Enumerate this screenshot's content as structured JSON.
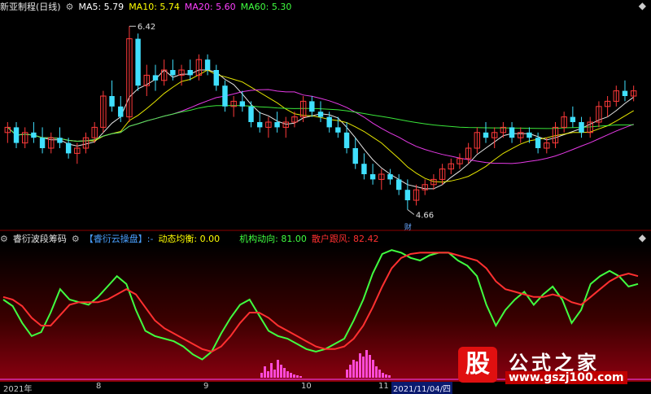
{
  "main_header": {
    "title": "新亚制程(日线)",
    "ma": [
      {
        "label": "MA5: 5.79",
        "color": "#ffffff"
      },
      {
        "label": "MA10: 5.74",
        "color": "#ffff00"
      },
      {
        "label": "MA20: 5.60",
        "color": "#ff40ff"
      },
      {
        "label": "MA60: 5.30",
        "color": "#40ff40"
      }
    ]
  },
  "main_chart": {
    "high_label": "6.42",
    "low_label": "4.66",
    "marker_cai": "财",
    "price_range": [
      4.5,
      6.5
    ]
  },
  "sub_header": {
    "title": "睿衍波段筹码",
    "indicator": "【睿衍云操盘】:-",
    "dynamic_label": "动态均衡: 0.00",
    "inst_label": "机构动向: 81.00",
    "retail_label": "散户跟风: 82.42",
    "colors": {
      "dynamic": "#ffff00",
      "inst": "#40ff40",
      "retail": "#ff3030"
    }
  },
  "xaxis": {
    "ticks": [
      "2021年",
      "8",
      "9",
      "10",
      "11"
    ],
    "cursor_date": "2021/11/04/四"
  },
  "watermark": {
    "icon_text": "股",
    "name": "公式之家",
    "url": "www.gszj100.com"
  },
  "chart_data": [
    {
      "type": "candlestick",
      "title": "新亚制程(日线)",
      "ylim": [
        4.5,
        6.5
      ],
      "candles": [
        [
          5.4,
          5.5,
          5.3,
          5.45
        ],
        [
          5.45,
          5.5,
          5.25,
          5.3
        ],
        [
          5.3,
          5.45,
          5.25,
          5.4
        ],
        [
          5.4,
          5.5,
          5.3,
          5.35
        ],
        [
          5.35,
          5.45,
          5.2,
          5.25
        ],
        [
          5.25,
          5.4,
          5.2,
          5.35
        ],
        [
          5.35,
          5.45,
          5.25,
          5.3
        ],
        [
          5.3,
          5.35,
          5.15,
          5.2
        ],
        [
          5.2,
          5.3,
          5.1,
          5.25
        ],
        [
          5.25,
          5.4,
          5.2,
          5.35
        ],
        [
          5.35,
          5.5,
          5.3,
          5.45
        ],
        [
          5.45,
          5.8,
          5.4,
          5.75
        ],
        [
          5.75,
          5.9,
          5.6,
          5.65
        ],
        [
          5.65,
          5.75,
          5.5,
          5.55
        ],
        [
          5.55,
          6.42,
          5.5,
          6.3
        ],
        [
          6.3,
          6.35,
          5.8,
          5.85
        ],
        [
          5.85,
          6.05,
          5.75,
          5.95
        ],
        [
          5.95,
          6.05,
          5.8,
          5.9
        ],
        [
          5.9,
          6.1,
          5.85,
          6.0
        ],
        [
          6.0,
          6.1,
          5.9,
          5.95
        ],
        [
          5.95,
          6.05,
          5.85,
          6.0
        ],
        [
          6.0,
          6.1,
          5.9,
          5.95
        ],
        [
          5.95,
          6.15,
          5.9,
          6.1
        ],
        [
          6.1,
          6.15,
          5.95,
          6.0
        ],
        [
          6.0,
          6.05,
          5.8,
          5.85
        ],
        [
          5.85,
          5.9,
          5.6,
          5.65
        ],
        [
          5.65,
          5.75,
          5.55,
          5.7
        ],
        [
          5.7,
          5.8,
          5.6,
          5.65
        ],
        [
          5.65,
          5.7,
          5.45,
          5.5
        ],
        [
          5.5,
          5.6,
          5.4,
          5.45
        ],
        [
          5.45,
          5.55,
          5.35,
          5.5
        ],
        [
          5.5,
          5.6,
          5.4,
          5.45
        ],
        [
          5.45,
          5.55,
          5.35,
          5.5
        ],
        [
          5.5,
          5.6,
          5.45,
          5.55
        ],
        [
          5.55,
          5.75,
          5.5,
          5.7
        ],
        [
          5.7,
          5.75,
          5.55,
          5.6
        ],
        [
          5.6,
          5.7,
          5.5,
          5.55
        ],
        [
          5.55,
          5.6,
          5.4,
          5.45
        ],
        [
          5.45,
          5.55,
          5.35,
          5.4
        ],
        [
          5.4,
          5.5,
          5.2,
          5.25
        ],
        [
          5.25,
          5.35,
          5.05,
          5.1
        ],
        [
          5.1,
          5.2,
          4.95,
          5.0
        ],
        [
          5.0,
          5.1,
          4.9,
          4.95
        ],
        [
          4.95,
          5.05,
          4.85,
          5.0
        ],
        [
          5.0,
          5.05,
          4.9,
          4.95
        ],
        [
          4.95,
          5.0,
          4.8,
          4.85
        ],
        [
          4.85,
          4.95,
          4.66,
          4.75
        ],
        [
          4.75,
          4.9,
          4.7,
          4.85
        ],
        [
          4.85,
          4.95,
          4.8,
          4.9
        ],
        [
          4.9,
          5.0,
          4.85,
          4.95
        ],
        [
          4.95,
          5.1,
          4.9,
          5.05
        ],
        [
          5.05,
          5.15,
          5.0,
          5.1
        ],
        [
          5.1,
          5.2,
          5.05,
          5.15
        ],
        [
          5.15,
          5.3,
          5.1,
          5.25
        ],
        [
          5.25,
          5.45,
          5.2,
          5.4
        ],
        [
          5.4,
          5.5,
          5.3,
          5.35
        ],
        [
          5.35,
          5.45,
          5.25,
          5.4
        ],
        [
          5.4,
          5.5,
          5.35,
          5.45
        ],
        [
          5.45,
          5.5,
          5.3,
          5.35
        ],
        [
          5.35,
          5.45,
          5.3,
          5.4
        ],
        [
          5.4,
          5.45,
          5.3,
          5.35
        ],
        [
          5.35,
          5.4,
          5.2,
          5.25
        ],
        [
          5.25,
          5.35,
          5.2,
          5.3
        ],
        [
          5.3,
          5.5,
          5.25,
          5.45
        ],
        [
          5.45,
          5.6,
          5.4,
          5.55
        ],
        [
          5.55,
          5.65,
          5.45,
          5.5
        ],
        [
          5.5,
          5.55,
          5.35,
          5.4
        ],
        [
          5.4,
          5.55,
          5.35,
          5.5
        ],
        [
          5.5,
          5.7,
          5.45,
          5.65
        ],
        [
          5.65,
          5.75,
          5.55,
          5.7
        ],
        [
          5.7,
          5.85,
          5.65,
          5.8
        ],
        [
          5.8,
          5.9,
          5.7,
          5.75
        ],
        [
          5.75,
          5.85,
          5.7,
          5.8
        ]
      ]
    },
    {
      "type": "line",
      "title": "睿衍波段筹码",
      "ylim": [
        0,
        100
      ],
      "series": [
        {
          "name": "机构动向",
          "color": "#40ff40",
          "values": [
            60,
            55,
            42,
            32,
            35,
            50,
            68,
            60,
            58,
            56,
            62,
            70,
            78,
            72,
            52,
            36,
            32,
            30,
            28,
            24,
            18,
            14,
            20,
            34,
            46,
            56,
            60,
            48,
            36,
            32,
            30,
            26,
            22,
            20,
            22,
            26,
            30,
            44,
            60,
            80,
            95,
            98,
            96,
            92,
            90,
            94,
            96,
            96,
            90,
            86,
            78,
            56,
            40,
            52,
            60,
            66,
            56,
            64,
            70,
            60,
            42,
            52,
            72,
            78,
            82,
            78,
            70,
            72
          ]
        },
        {
          "name": "散户跟风",
          "color": "#ff3030",
          "values": [
            62,
            60,
            55,
            46,
            40,
            40,
            48,
            56,
            58,
            58,
            58,
            60,
            64,
            68,
            64,
            54,
            44,
            38,
            34,
            30,
            26,
            22,
            20,
            24,
            32,
            42,
            50,
            50,
            46,
            40,
            36,
            32,
            28,
            24,
            22,
            22,
            24,
            30,
            40,
            54,
            70,
            84,
            92,
            95,
            96,
            96,
            96,
            96,
            94,
            92,
            90,
            84,
            74,
            68,
            66,
            64,
            62,
            62,
            64,
            62,
            58,
            56,
            62,
            68,
            74,
            78,
            80,
            78
          ]
        }
      ],
      "volume_bars_pink": [
        0,
        0,
        0,
        0,
        0,
        0,
        0,
        0,
        0,
        0,
        0,
        0,
        0,
        0,
        0,
        0,
        0,
        0,
        0,
        0,
        0,
        0,
        0,
        0,
        0,
        0,
        0,
        0,
        0,
        0,
        0,
        0,
        0,
        0,
        0,
        0,
        0,
        0,
        0,
        0,
        0,
        0,
        0,
        0,
        0,
        0,
        0,
        0,
        0,
        0,
        0,
        0,
        0,
        0,
        0,
        0,
        0,
        0,
        0,
        0,
        0,
        0,
        0,
        0,
        0,
        0,
        0,
        0
      ]
    }
  ]
}
